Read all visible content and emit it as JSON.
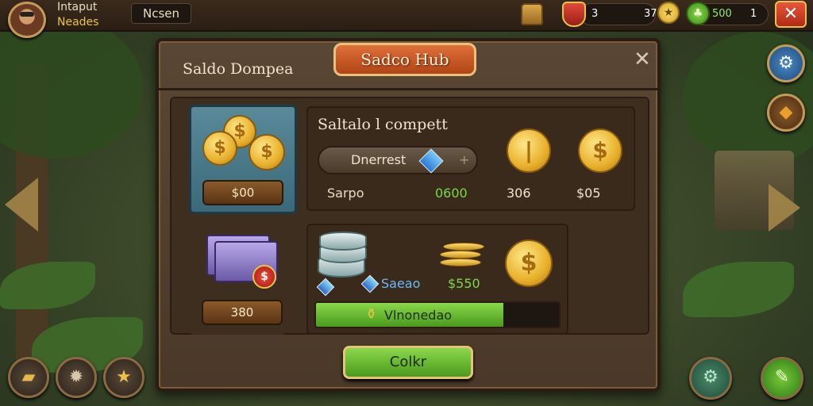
{
  "player": {
    "name": "Intaput",
    "subtitle": "Neades"
  },
  "topbar": {
    "name_box": "Ncsen",
    "resource_left_value": "3",
    "resource_left_amount": "37",
    "resource_right_value": "500",
    "resource_right_count": "1",
    "close_label": "✕"
  },
  "panel": {
    "title": "Sadco Hub",
    "subtitle": "Saldo Dompea",
    "close_label": "✕"
  },
  "coins_card": {
    "price": "$00"
  },
  "tickets_card": {
    "price": "380"
  },
  "compete": {
    "title": "Saltalo l compett",
    "dropdown_label": "Dnerrest",
    "dropdown_plus": "+",
    "row_label": "Sarpo",
    "row_value": "0600",
    "price_1": "306",
    "price_2": "$05"
  },
  "reward": {
    "label": "Saeao",
    "value": "$550",
    "progress_label": "Vlnonedao",
    "progress_fraction": 0.77
  },
  "collect_label": "Colkr",
  "colors": {
    "accent_gold": "#e8c24a",
    "progress_green": "#8ad84a",
    "title_orange": "#e0703a"
  },
  "icons": [
    "avatar",
    "chest-icon",
    "shield-icon",
    "star-coin-icon",
    "clover-icon",
    "gear-icon",
    "diamond-icon",
    "arrow-left-icon",
    "arrow-right-icon",
    "map-icon",
    "settings-icon",
    "star-icon",
    "gear-green-icon",
    "pencil-icon"
  ]
}
